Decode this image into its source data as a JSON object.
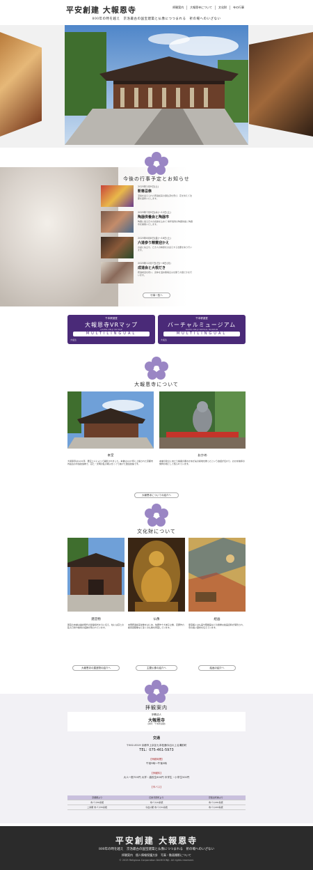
{
  "header": {
    "logo": "平安創建 大報恩寺",
    "nav": [
      "拝観案内",
      "大報恩寺について",
      "文化財",
      "寺の行事"
    ],
    "tagline": "800年の時を越え　京洛最古の国宝建築と仏像につつまれる　祈の場へのいざない"
  },
  "news": {
    "title": "今後の行事予定とお知らせ",
    "items": [
      {
        "date": "2025年2月9日(土)",
        "title": "釈尊忌祭",
        "desc": "涅槃を迎えられた釈迦如来の御生涯を偲び、花を供えて法要を厳修いたします。"
      },
      {
        "date": "2025年7月9日(水)～12日(土)",
        "title": "陶器供養会と陶器市",
        "desc": "陶器に宿る日々の感謝を込めて 毎年恒例の陶器供養と陶器市を開催いたします。"
      },
      {
        "date": "2025年8月8日(金)～16日(土)",
        "title": "六道参り精霊迎かえ",
        "desc": "お盆に先立ち、亡き人の精霊をお迎えする法要を執り行います。"
      },
      {
        "date": "2025年12月7日(日)～8日(月)",
        "title": "成道会と大根だき",
        "desc": "釈迦成道を祝い、身体を温め無病息災を願う大根だきを行います。"
      }
    ],
    "more": "行事一覧へ"
  },
  "banners": [
    {
      "top": "千本釈迦堂",
      "main": "大報恩寺VRマップ",
      "sub": "DAIHO-ON-JI VR MAP",
      "ml": "MULTILINGUAL",
      "foot": "大坂急"
    },
    {
      "top": "千本釈迦堂",
      "main": "バーチャルミュージアム",
      "sub": "DAIHO-ON-JI VIRTUAL MUSEUM",
      "ml": "MULTILINGUAL",
      "foot": "大坂急"
    }
  ],
  "about": {
    "title": "大報恩寺について",
    "cap1": "本堂",
    "cap2": "おかめ",
    "text1": "大報恩寺は1221年、義空上人によって開創されました。本堂は1227年に上棟された京都市内最古の木造建造物で、応仁・文明の乱の戦火をくぐり抜けた国宝建築です。",
    "text2": "本堂の建立にあたり棟梁の妻おかめが夫の窮地を救ったという逸話が伝わり、おかめ信仰の発祥の地として知られています。",
    "more": "大報恩寺についての紹介へ"
  },
  "bunkazai": {
    "title": "文化財について",
    "items": [
      {
        "cap": "建造物",
        "text": "国宝の本堂は鎌倉時代の建築様式を今に伝え、柱には応仁の乱の刀傷や槍傷の痕跡が残されています。",
        "more": "大報恩寺の建造物の紹介へ"
      },
      {
        "cap": "仏像",
        "text": "本尊釈迦如来坐像をはじめ、快慶作十大弟子立像、定慶作六観音菩薩像など多くの仏像を所蔵しています。",
        "more": "主要仏像の紹介へ"
      },
      {
        "cap": "絵画",
        "text": "霊宝殿には仏画や障壁画などの貴重な絵画資料が保管され、寺の長い歴史を伝えています。",
        "more": "絵画の紹介へ"
      }
    ]
  },
  "visit": {
    "title": "拝観案内",
    "org": "宗教法人",
    "name": "大報恩寺",
    "name_sub": "(通称：千本釈迦堂)",
    "access_label": "交通",
    "address": "〒602-8319 京都市上京区七本松通今出川上る溝前町",
    "tel": "TEL：075-461-5973",
    "hours_label": "【拝観時間】",
    "hours": "午前9時～午後5時",
    "fee_label": "【拝観料】",
    "fee": "大人一般700円 大学・高校生600円 中学生・小学生500円",
    "bus_label": "【市バス】",
    "table_heads": [
      "京都駅より",
      "四条河原町より",
      "京阪出町柳より"
    ],
    "table_rows": [
      [
        "市バス50系統",
        "市バス10系統",
        "市バス201系統"
      ],
      [
        "二条駅 市バス55系統",
        "今出川駅 市バス51系統",
        "市バス203系統"
      ]
    ]
  },
  "footer": {
    "logo": "平安創建 大報恩寺",
    "tagline": "800年の時を越え　京洛最古の国宝建築と仏像につつまれる　祈の場へのいざない",
    "links": "拝観案内　個人情報保護方針　写真・動画撮影について",
    "copyright": "© 2025 Religious Corporation DAIHOONJI. All rights reserved."
  }
}
